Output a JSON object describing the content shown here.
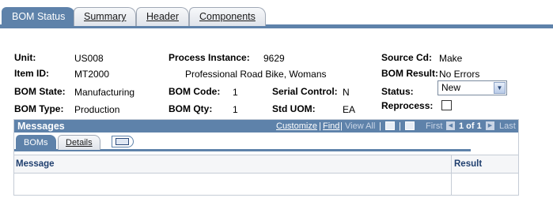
{
  "tabs": [
    {
      "label": "BOM Status",
      "active": true
    },
    {
      "label": "Summary",
      "active": false
    },
    {
      "label": "Header",
      "active": false
    },
    {
      "label": "Components",
      "active": false
    }
  ],
  "fields": {
    "unit": {
      "label": "Unit:",
      "value": "US008"
    },
    "item_id": {
      "label": "Item ID:",
      "value": "MT2000"
    },
    "bom_state": {
      "label": "BOM State:",
      "value": "Manufacturing"
    },
    "bom_type": {
      "label": "BOM Type:",
      "value": "Production"
    },
    "process_instance": {
      "label": "Process Instance:",
      "value": "9629"
    },
    "item_description": {
      "value": "Professional Road Bike, Womans"
    },
    "bom_code": {
      "label": "BOM Code:",
      "value": "1"
    },
    "bom_qty": {
      "label": "BOM Qty:",
      "value": "1"
    },
    "serial_control": {
      "label": "Serial Control:",
      "value": "N"
    },
    "std_uom": {
      "label": "Std UOM:",
      "value": "EA"
    },
    "source_cd": {
      "label": "Source Cd:",
      "value": "Make"
    },
    "bom_result": {
      "label": "BOM Result:",
      "value": "No Errors"
    },
    "status": {
      "label": "Status:",
      "value": "New"
    },
    "reprocess": {
      "label": "Reprocess:",
      "checked": false
    }
  },
  "messages_grid": {
    "title": "Messages",
    "nav": {
      "customize": "Customize",
      "separator": "|",
      "find": "Find",
      "view_all": "View All",
      "first": "First",
      "range": "1 of 1",
      "last": "Last"
    },
    "subtabs": [
      {
        "label": "BOMs",
        "active": true
      },
      {
        "label": "Details",
        "active": false
      }
    ],
    "columns": [
      "Message",
      "Result"
    ],
    "rows": [
      {
        "message": "",
        "result": ""
      }
    ]
  }
}
